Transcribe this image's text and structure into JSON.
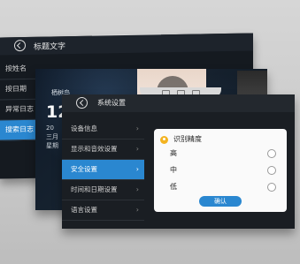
{
  "back_screen": {
    "title": "标题文字",
    "menu": [
      {
        "label": "按姓名"
      },
      {
        "label": "按日期"
      },
      {
        "label": "异常日志"
      },
      {
        "label": "搜索日志"
      }
    ]
  },
  "middle_screen": {
    "label": "栖树鸟",
    "clock": "12:",
    "date_line1": "20",
    "date_line2": "三月",
    "date_line3": "星期"
  },
  "front_screen": {
    "title": "系统设置",
    "menu": [
      {
        "label": "设备信息",
        "chevron": "›"
      },
      {
        "label": "显示和音效设置",
        "chevron": "›"
      },
      {
        "label": "安全设置",
        "chevron": "›"
      },
      {
        "label": "时间和日期设置",
        "chevron": "›"
      },
      {
        "label": "语言设置",
        "chevron": "›"
      }
    ],
    "dialog": {
      "title": "识别精度",
      "options": [
        {
          "label": "高"
        },
        {
          "label": "中"
        },
        {
          "label": "低"
        }
      ],
      "confirm": "确认"
    }
  },
  "colors": {
    "accent": "#2a87d0",
    "warning_icon": "#f3b320"
  }
}
